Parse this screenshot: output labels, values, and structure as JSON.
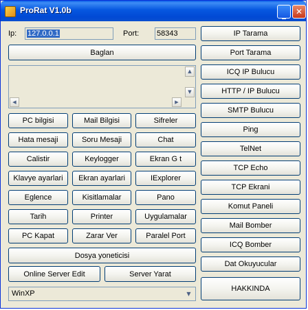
{
  "window": {
    "title": "ProRat V1.0b"
  },
  "connection": {
    "ip_label": "Ip:",
    "ip_value": "127.0.0.1",
    "port_label": "Port:",
    "port_value": "58343",
    "connect_label": "Baglan"
  },
  "functions": [
    "PC bilgisi",
    "Mail Bilgisi",
    "Sifreler",
    "Hata mesaji",
    "Soru Mesaji",
    "Chat",
    "Calistir",
    "Keylogger",
    "Ekran G  t",
    "Klavye ayarlari",
    "Ekran ayarlari",
    "IExplorer",
    "Eglence",
    "Kisitlamalar",
    "Pano",
    "Tarih",
    "Printer",
    "Uygulamalar",
    "PC Kapat",
    "Zarar Ver",
    "Paralel Port"
  ],
  "file_manager_label": "Dosya yoneticisi",
  "online_server_edit_label": "Online Server Edit",
  "server_create_label": "Server Yarat",
  "os_select": {
    "selected": "WinXP"
  },
  "tools": [
    "IP Tarama",
    "Port Tarama",
    "ICQ IP Bulucu",
    "HTTP / IP Bulucu",
    "SMTP Bulucu",
    "Ping",
    "TelNet",
    "TCP Echo",
    "TCP Ekrani",
    "Komut Paneli",
    "Mail Bomber",
    "ICQ Bomber",
    "Dat Okuyucular"
  ],
  "about_label": "HAKKINDA"
}
